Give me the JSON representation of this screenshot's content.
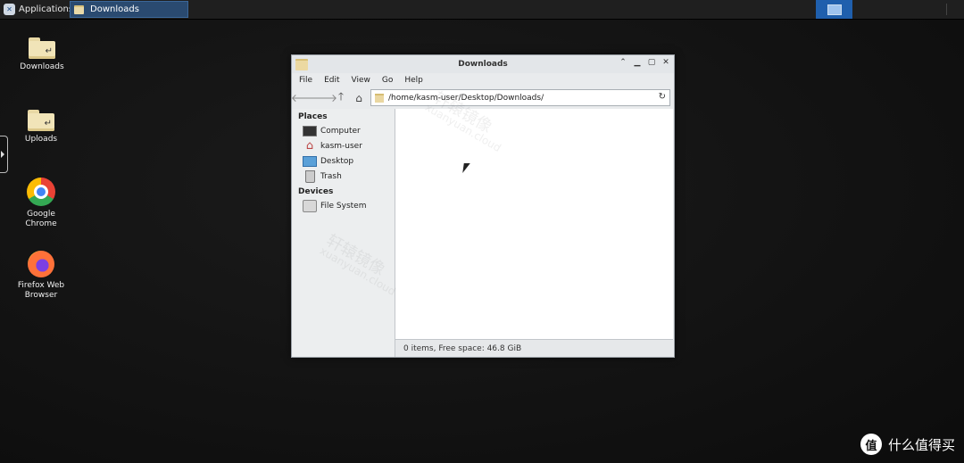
{
  "panel": {
    "apps_label": "Applications",
    "task_label": "Downloads"
  },
  "desktop": {
    "icons": [
      {
        "label": "Downloads",
        "icon": "folder-link-icon"
      },
      {
        "label": "Uploads",
        "icon": "folder-link-icon"
      },
      {
        "label": "Google Chrome",
        "icon": "chrome-icon"
      },
      {
        "label": "Firefox Web Browser",
        "icon": "firefox-icon"
      }
    ]
  },
  "window": {
    "title": "Downloads",
    "menu": [
      "File",
      "Edit",
      "View",
      "Go",
      "Help"
    ],
    "address": "/home/kasm-user/Desktop/Downloads/",
    "sidebar": {
      "places_header": "Places",
      "places": [
        {
          "label": "Computer",
          "icon": "computer-icon"
        },
        {
          "label": "kasm-user",
          "icon": "home-icon"
        },
        {
          "label": "Desktop",
          "icon": "desktop-icon"
        },
        {
          "label": "Trash",
          "icon": "trash-icon"
        }
      ],
      "devices_header": "Devices",
      "devices": [
        {
          "label": "File System",
          "icon": "drive-icon"
        }
      ]
    },
    "status": "0 items, Free space: 46.8 GiB"
  },
  "watermark": {
    "text_cn": "轩辕镜像",
    "text_en": "xuanyuan.cloud"
  },
  "brand": {
    "logo": "值",
    "text": "什么值得买"
  }
}
